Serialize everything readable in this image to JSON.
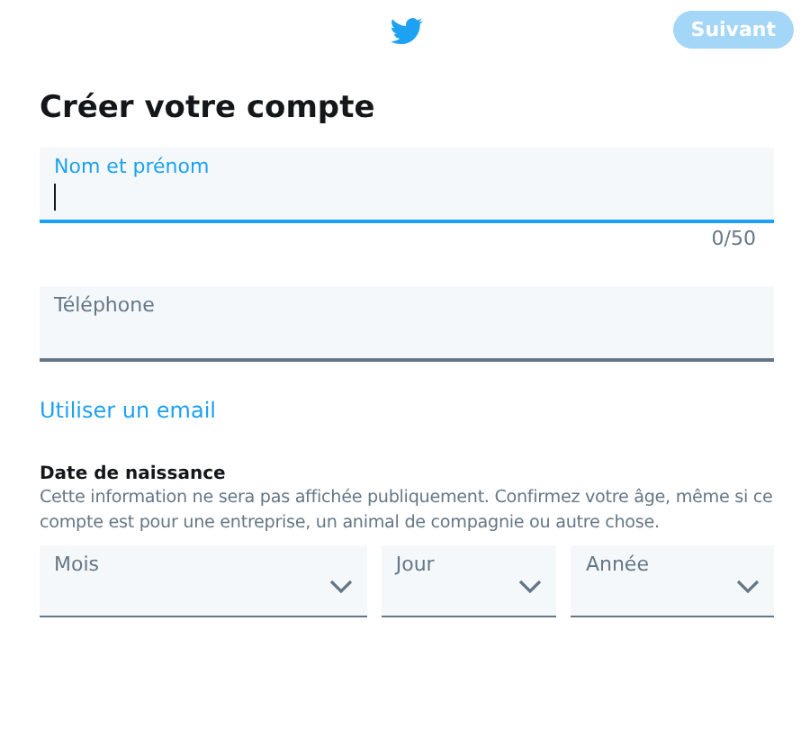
{
  "header": {
    "next_button": {
      "label": "Suivant",
      "disabled": true
    }
  },
  "title": "Créer votre compte",
  "fields": [
    {
      "label": "Nom et prénom",
      "focused": true,
      "counter": "0/50"
    },
    {
      "label": "Téléphone",
      "focused": false
    }
  ],
  "switch_link": "Utiliser un email",
  "birth_date": {
    "heading": "Date de naissance",
    "description": "Cette information ne sera pas affichée publiquement. Confirmez votre âge, même si ce compte est pour une entreprise, un animal de compagnie ou autre chose.",
    "selects": [
      {
        "label": "Mois"
      },
      {
        "label": "Jour"
      },
      {
        "label": "Année"
      }
    ]
  }
}
